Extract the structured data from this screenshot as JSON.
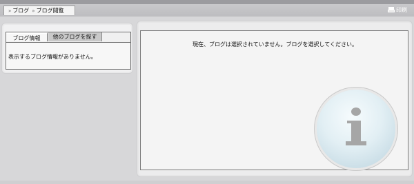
{
  "header": {
    "breadcrumb": [
      "ブログ",
      "ブログ閲覧"
    ],
    "print_label": "印刷",
    "print_icon": "printer-icon"
  },
  "left_panel": {
    "tabs": [
      {
        "label": "ブログ情報",
        "active": true
      },
      {
        "label": "他のブログを探す",
        "active": false
      }
    ],
    "message": "表示するブログ情報がありません。"
  },
  "right_panel": {
    "message": "現在、ブログは選択されていません。ブログを選択してください。",
    "icon": "info-icon"
  },
  "colors": {
    "background": "#d7d7d9",
    "panel": "#f4f4f4",
    "border": "#777777",
    "inactive_tab": "#c9c9c9",
    "info_circle": "#d6e8ee",
    "info_glyph": "#a6a6a6"
  }
}
